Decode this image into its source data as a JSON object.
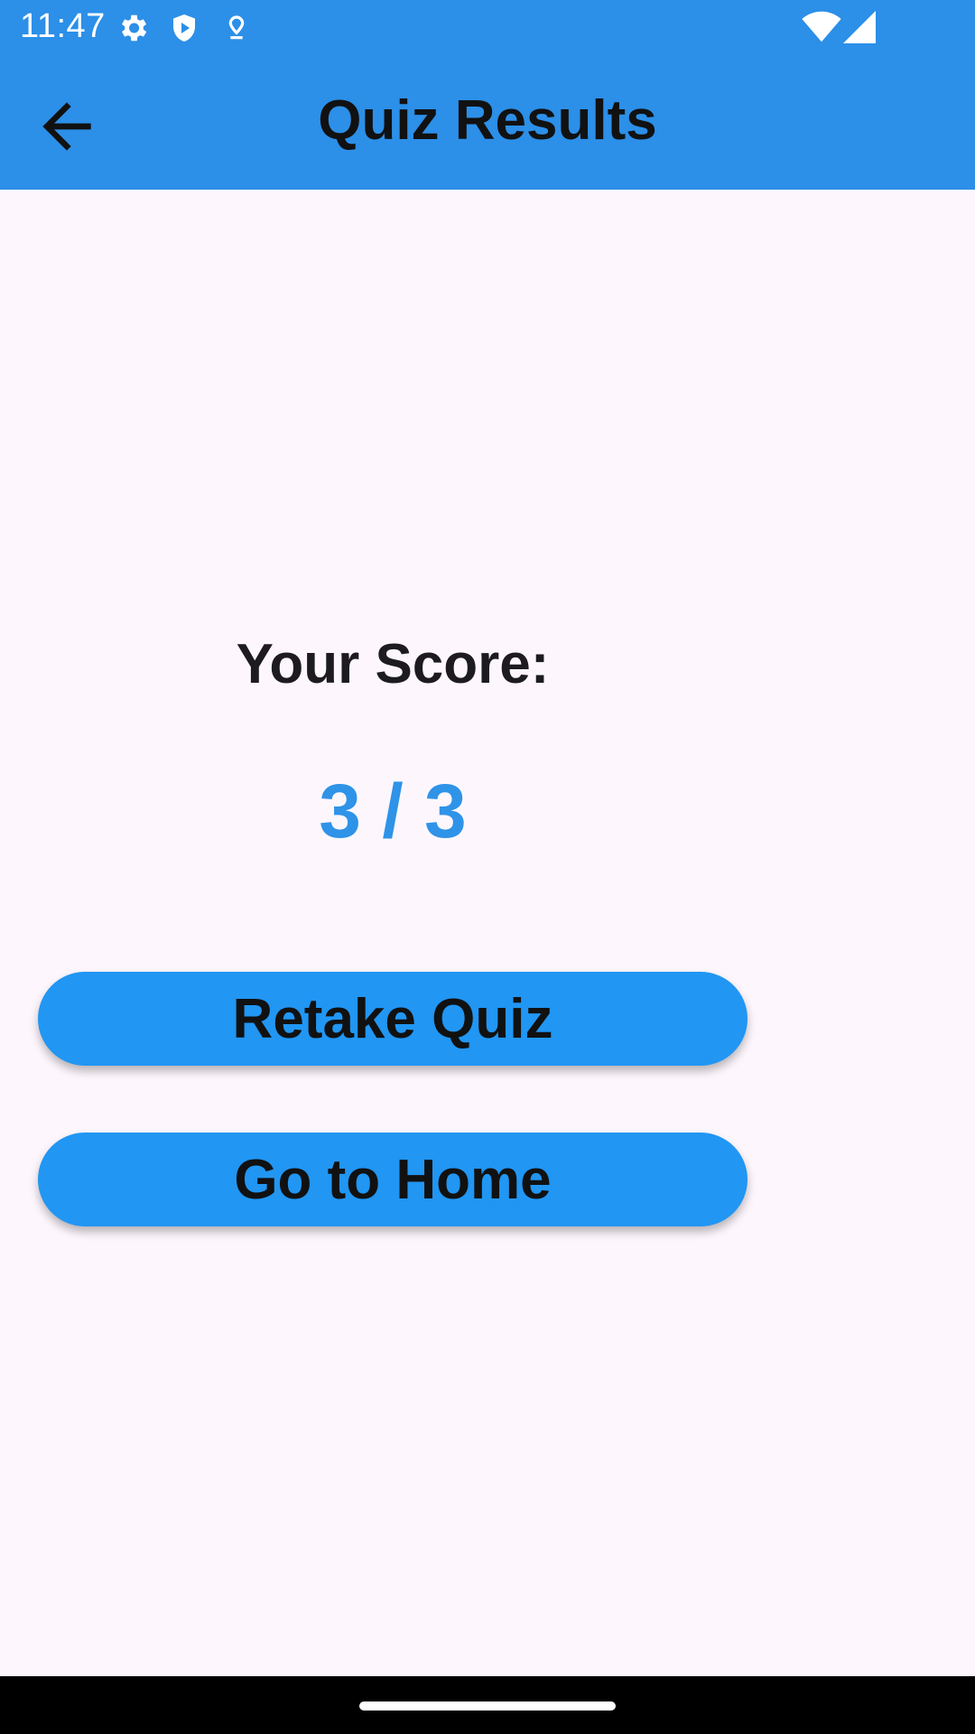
{
  "status_bar": {
    "time": "11:47",
    "icons": [
      "gear-icon",
      "shield-play-icon",
      "location-pin-icon",
      "wifi-icon",
      "cell-signal-icon"
    ]
  },
  "app_bar": {
    "title": "Quiz Results",
    "back_icon": "arrow-back-icon"
  },
  "result": {
    "label": "Your Score:",
    "score": "3 / 3"
  },
  "actions": {
    "retake_label": "Retake Quiz",
    "home_label": "Go to Home"
  },
  "colors": {
    "app_bar": "#2c8fe8",
    "background": "#fdf7fd",
    "score": "#2f93e8",
    "button": "#2196f3"
  }
}
